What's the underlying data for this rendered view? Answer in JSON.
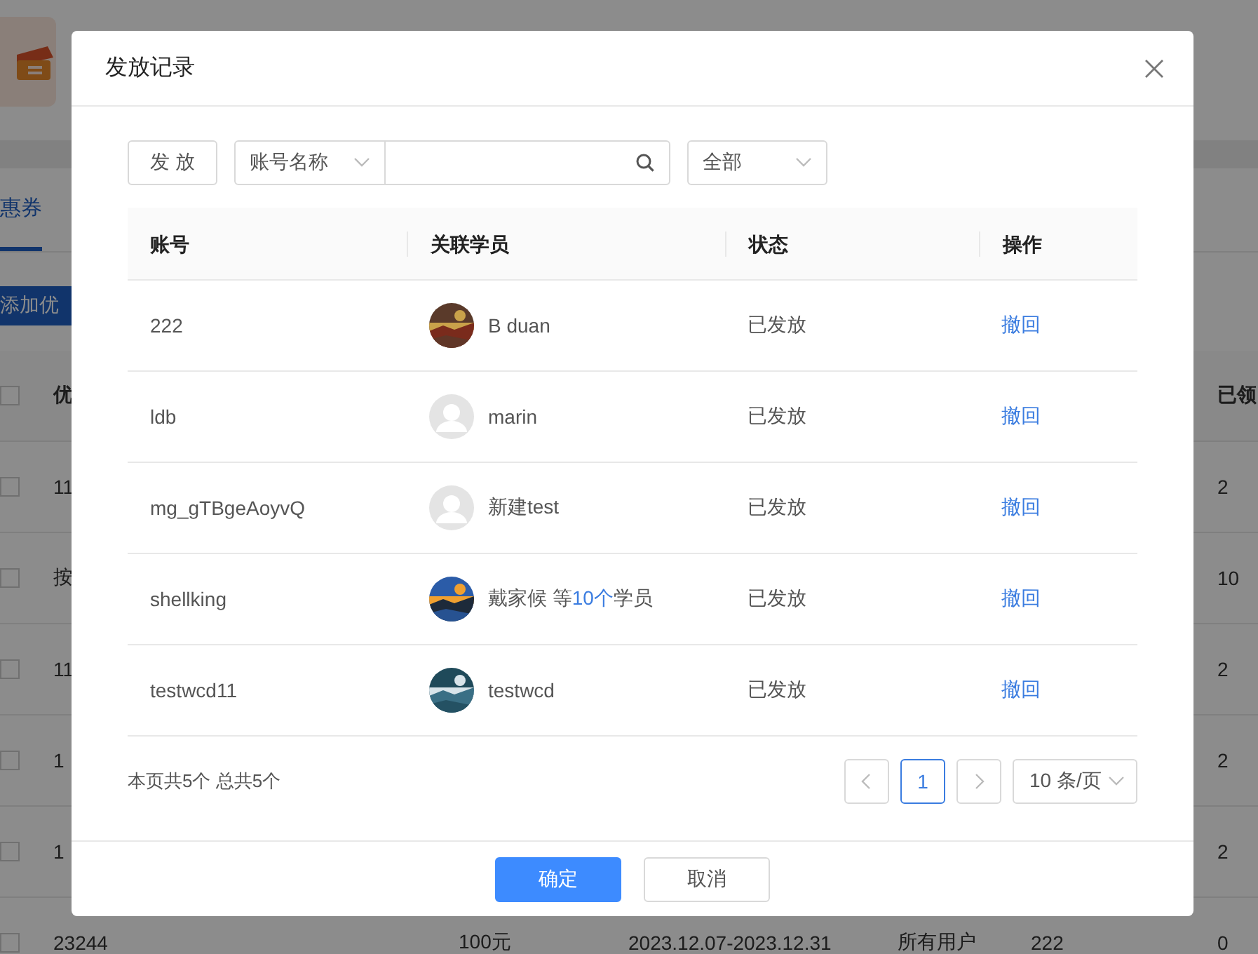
{
  "background": {
    "tab": {
      "label": "惠券",
      "selected": true
    },
    "add_button": "添加优",
    "table": {
      "checked": false,
      "columns": [
        {
          "label": "优"
        },
        {
          "label": "已领"
        }
      ],
      "rows": [
        {
          "checked": false,
          "column_1": "11",
          "claimed": "2"
        },
        {
          "checked": false,
          "column_1": "按",
          "claimed": "10"
        },
        {
          "checked": false,
          "column_1": "11",
          "claimed": "2"
        },
        {
          "checked": false,
          "column_1": "1",
          "claimed": "2"
        },
        {
          "checked": false,
          "column_1": "1",
          "claimed": "2"
        },
        {
          "checked": false,
          "column_1": "23244",
          "amount": "100元",
          "period": "2023.12.07-2023.12.31",
          "scope": "所有用户",
          "column_5": "222",
          "claimed": "0"
        }
      ]
    }
  },
  "dialog": {
    "title": "发放记录",
    "toolbar": {
      "issue_button": "发 放",
      "field_select": "账号名称",
      "status_select": "全部"
    },
    "columns": [
      "账号",
      "关联学员",
      "状态",
      "操作"
    ],
    "rows": [
      {
        "account": "222",
        "student": "B duan",
        "status": "已发放",
        "action": "撤回"
      },
      {
        "account": "ldb",
        "avatar": {
          "kind": "default"
        },
        "student": "marin",
        "status": "已发放",
        "action": "撤回"
      },
      {
        "account": "mg_gTBgeAoyvQ",
        "avatar": {
          "kind": "default"
        },
        "student": "新建test",
        "status": "已发放",
        "action": "撤回"
      },
      {
        "account": "shellking",
        "student": "戴家候",
        "more": {
          "prefix": "等",
          "link": "10个",
          "suffix": "学员"
        },
        "status": "已发放",
        "action": "撤回"
      },
      {
        "account": "testwcd11",
        "student": "testwcd",
        "status": "已发放",
        "action": "撤回"
      }
    ],
    "summary": "本页共5个 总共5个",
    "pagination": {
      "pages": [
        {
          "label": "1",
          "selected": true
        }
      ],
      "page_size": "10 条/页"
    },
    "buttons": {
      "ok": "确定",
      "cancel": "取消"
    }
  }
}
